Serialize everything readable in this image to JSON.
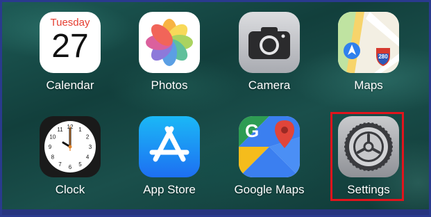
{
  "home_screen": {
    "apps": [
      {
        "label": "Calendar",
        "icon": "calendar-icon",
        "day": "Tuesday",
        "date": "27"
      },
      {
        "label": "Photos",
        "icon": "photos-icon"
      },
      {
        "label": "Camera",
        "icon": "camera-icon"
      },
      {
        "label": "Maps",
        "icon": "maps-icon",
        "badge": "280"
      },
      {
        "label": "Clock",
        "icon": "clock-icon",
        "clock_numbers": [
          "12",
          "1",
          "2",
          "3",
          "4",
          "5",
          "6",
          "7",
          "8",
          "9",
          "10",
          "11"
        ]
      },
      {
        "label": "App Store",
        "icon": "app-store-icon"
      },
      {
        "label": "Google Maps",
        "icon": "google-maps-icon",
        "glyph": "G"
      },
      {
        "label": "Settings",
        "icon": "gear-icon"
      }
    ],
    "highlighted_app": "Settings",
    "colors": {
      "border": "#2a3a8e",
      "highlight": "#e1141c",
      "calendar_red": "#e53d30"
    }
  }
}
